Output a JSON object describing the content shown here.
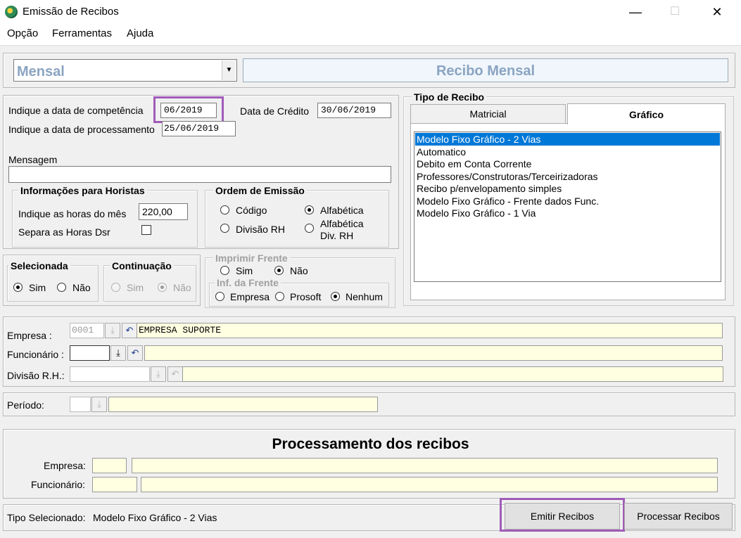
{
  "window": {
    "title": "Emissão de Recibos",
    "minimize": "—",
    "maximize": "☐",
    "close": "✕"
  },
  "menu": [
    "Opção",
    "Ferramentas",
    "Ajuda"
  ],
  "top": {
    "combo_value": "Mensal",
    "banner": "Recibo Mensal"
  },
  "dates": {
    "competencia_label": "Indique a data de competência",
    "competencia_value": "06/2019",
    "credito_label": "Data de Crédito",
    "credito_value": "30/06/2019",
    "processamento_label": "Indique a data de processamento",
    "processamento_value": "25/06/2019",
    "mensagem_label": "Mensagem",
    "mensagem_value": ""
  },
  "horistas": {
    "title": "Informações para Horistas",
    "horas_label": "Indique as horas do mês",
    "horas_value": "220,00",
    "dsr_label": "Separa as Horas Dsr"
  },
  "ordem": {
    "title": "Ordem de Emissão",
    "codigo": "Código",
    "alfabetica": "Alfabética",
    "divisao": "Divisão RH",
    "alfa_div_1": "Alfabética",
    "alfa_div_2": "Div. RH"
  },
  "selecionada": {
    "title": "Selecionada",
    "sim": "Sim",
    "nao": "Não"
  },
  "continuacao": {
    "title": "Continuação",
    "sim": "Sim",
    "nao": "Não"
  },
  "imprimir": {
    "title": "Imprimir Frente",
    "sim": "Sim",
    "nao": "Não"
  },
  "inf": {
    "title": "Inf. da Frente",
    "empresa": "Empresa",
    "prosoft": "Prosoft",
    "nenhum": "Nenhum"
  },
  "tipo": {
    "title": "Tipo de Recibo",
    "tab_matricial": "Matricial",
    "tab_grafico": "Gráfico",
    "items": [
      "Modelo Fixo Gráfico - 2 Vias",
      "Automatico",
      "Debito em Conta Corrente",
      "Professores/Construtoras/Terceirizadoras",
      "Recibo p/envelopamento simples",
      "Modelo Fixo Gráfico - Frente dados Func.",
      "Modelo Fixo Gráfico - 1 Via"
    ]
  },
  "filters": {
    "empresa_label": "Empresa :",
    "empresa_code": "0001",
    "empresa_name": "EMPRESA SUPORTE",
    "funcionario_label": "Funcionário :",
    "divisao_label": "Divisão R.H.:",
    "periodo_label": "Período:"
  },
  "processamento": {
    "title": "Processamento dos recibos",
    "empresa_label": "Empresa:",
    "funcionario_label": "Funcionário:"
  },
  "footer": {
    "tipo_label": "Tipo Selecionado:",
    "tipo_value": "Modelo Fixo Gráfico - 2 Vias",
    "emitir": "Emitir Recibos",
    "processar": "Processar Recibos"
  },
  "colors": {
    "selection": "#0078d7",
    "highlight": "#a05cb8",
    "banner_text": "#8aa4c2",
    "input_yellow": "#ffffe1"
  }
}
